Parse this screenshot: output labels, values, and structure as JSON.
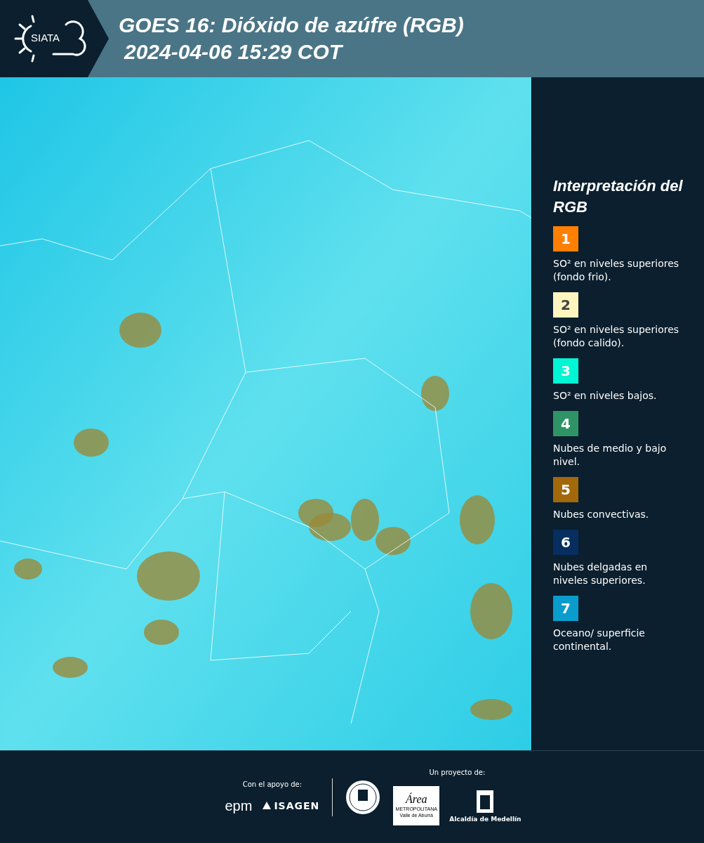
{
  "header": {
    "logo_text": "SIATA",
    "title": "GOES 16: Dióxido de azúfre (RGB)",
    "timestamp": "2024-04-06 15:29 COT"
  },
  "legend": {
    "title": "Interpretación del RGB",
    "items": [
      {
        "number": "1",
        "color": "#ff7f00",
        "text": "SO² en niveles superiores (fondo frio)."
      },
      {
        "number": "2",
        "color": "#fff6bf",
        "text": "SO² en niveles superiores (fondo calido)."
      },
      {
        "number": "3",
        "color": "#00f5d4",
        "text": "SO² en niveles bajos."
      },
      {
        "number": "4",
        "color": "#2e9466",
        "text": "Nubes de medio y bajo nivel."
      },
      {
        "number": "5",
        "color": "#a3680a",
        "text": "Nubes convectivas."
      },
      {
        "number": "6",
        "color": "#062e5f",
        "text": "Nubes delgadas en niveles superiores."
      },
      {
        "number": "7",
        "color": "#0a9ccc",
        "text": "Oceano/ superficie continental."
      }
    ]
  },
  "footer": {
    "support_label": "Con el apoyo de:",
    "support_logos": [
      "epm",
      "ISAGEN"
    ],
    "project_label": "Un proyecto de:",
    "area_logo": {
      "title": "Área",
      "subtitle": "METROPOLITANA",
      "sub2": "Valle de Aburrá"
    },
    "alcaldia_label": "Alcaldía de Medellín"
  }
}
